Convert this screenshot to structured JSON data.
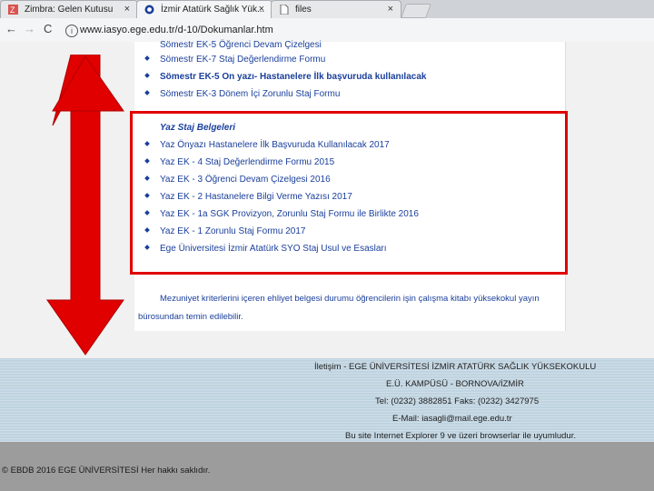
{
  "browser": {
    "tabs": [
      {
        "title": "Zimbra: Gelen Kutusu"
      },
      {
        "title": "İzmir Atatürk Sağlık Yük..."
      },
      {
        "title": "files"
      }
    ],
    "close_glyph": "×",
    "back_glyph": "←",
    "forward_glyph": "→",
    "reload_glyph": "C",
    "info_glyph": "i",
    "url": "www.iasyo.ege.edu.tr/d-10/Dokumanlar.htm"
  },
  "links_top": [
    {
      "text": "Sömestr EK-5 Öğrenci Devam Çizelgesi"
    },
    {
      "text": "Sömestr EK-7 Staj Değerlendirme Formu"
    },
    {
      "text": "Sömestr EK-5 On yazı- Hastanelere İlk başvuruda kullanılacak"
    },
    {
      "text": "Sömestr EK-3 Dönem İçi Zorunlu Staj Formu"
    }
  ],
  "yaz_staj": {
    "title": "Yaz Staj Belgeleri",
    "items": [
      "Yaz Önyazı Hastanelere İlk Başvuruda Kullanılacak 2017",
      "Yaz EK - 4 Staj Değerlendirme Formu 2015",
      "Yaz EK - 3 Öğrenci Devam Çizelgesi 2016",
      "Yaz EK - 2 Hastanelere Bilgi Verme Yazısı 2017",
      "Yaz EK - 1a SGK Provizyon, Zorunlu Staj Formu ile Birlikte 2016",
      "Yaz EK - 1 Zorunlu Staj Formu 2017",
      "Ege Üniversitesi İzmir Atatürk SYO Staj Usul ve Esasları"
    ]
  },
  "note": {
    "line1": "Mezuniyet kriterlerini içeren ehliyet belgesi durumu öğrencilerin işin çalışma kitabı yüksekokul yayın",
    "line2": "bürosundan temin edilebilir."
  },
  "footer": {
    "line1": "İletişim - EGE ÜNİVERSİTESİ İZMİR ATATÜRK SAĞLIK YÜKSEKOKULU",
    "line2": "E.Ü. KAMPÜSÜ - BORNOVA/İZMİR",
    "line3": "Tel: (0232) 3882851 Faks: (0232) 3427975",
    "line4": "E-Mail: iasagli@mail.ege.edu.tr",
    "line5": "Bu site Internet Explorer 9 ve üzeri browserlar ile uyumludur.",
    "copyright": "© EBDB 2016 EGE ÜNİVERSİTESİ Her hakkı saklıdır."
  },
  "colors": {
    "highlight": "#e00000",
    "link": "#1a3f9b",
    "footer": "#bfd3e0"
  }
}
